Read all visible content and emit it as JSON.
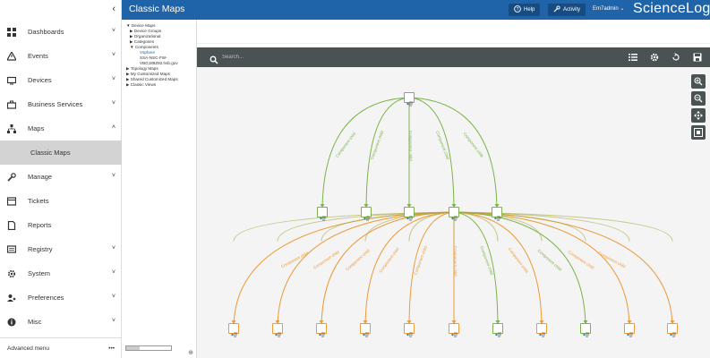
{
  "sidenav": {
    "collapse_glyph": "‹",
    "items": [
      {
        "label": "Dashboards",
        "icon": "dashboard-icon",
        "chevron": "˅"
      },
      {
        "label": "Events",
        "icon": "warning-icon",
        "chevron": "˅"
      },
      {
        "label": "Devices",
        "icon": "monitor-icon",
        "chevron": "˅"
      },
      {
        "label": "Business Services",
        "icon": "briefcase-icon",
        "chevron": "˅"
      },
      {
        "label": "Maps",
        "icon": "sitemap-icon",
        "chevron": "˄"
      },
      {
        "label": "Classic Maps",
        "icon": "",
        "chevron": ""
      },
      {
        "label": "Manage",
        "icon": "wrench-icon",
        "chevron": "˅"
      },
      {
        "label": "Tickets",
        "icon": "ticket-icon",
        "chevron": ""
      },
      {
        "label": "Reports",
        "icon": "report-icon",
        "chevron": ""
      },
      {
        "label": "Registry",
        "icon": "registry-icon",
        "chevron": "˅"
      },
      {
        "label": "System",
        "icon": "gear-icon",
        "chevron": "˅"
      },
      {
        "label": "Preferences",
        "icon": "user-gear-icon",
        "chevron": "˅"
      },
      {
        "label": "Misc",
        "icon": "info-circle-icon",
        "chevron": "˅"
      }
    ],
    "footer_label": "Advanced menu",
    "footer_more": "•••"
  },
  "topbar": {
    "title": "Classic Maps",
    "help_label": "Help",
    "activity_label": "Activity",
    "user_label": "Em7admin ⌄",
    "logo_text": "ScienceLogic",
    "bg_color": "#1f63a8"
  },
  "tree": {
    "rows": [
      {
        "text": "▼ Device Maps",
        "level": 0
      },
      {
        "text": "▶ Device Groups",
        "level": 1
      },
      {
        "text": "▶ Organizational",
        "level": 1
      },
      {
        "text": "▶ Categories",
        "level": 1
      },
      {
        "text": "▼ Components",
        "level": 1
      },
      {
        "text": "Vsphere",
        "level": 2,
        "selected": true
      },
      {
        "text": "SSA-NSC-FW-",
        "level": 2
      },
      {
        "text": "VBG189Z92.hsb.gov",
        "level": 2
      },
      {
        "text": "▶ Topology Maps",
        "level": 0
      },
      {
        "text": "▶ My Customized Maps",
        "level": 0
      },
      {
        "text": "▶ Shared Customized Maps",
        "level": 0
      },
      {
        "text": "▶ Classic Views",
        "level": 0
      }
    ]
  },
  "map": {
    "search_placeholder": "Search...",
    "edge_label": "Component child",
    "colors": {
      "green": "#7bb34a",
      "orange": "#ec9a3a",
      "olive": "#a5a83c",
      "toolbar": "#4b5254"
    }
  }
}
